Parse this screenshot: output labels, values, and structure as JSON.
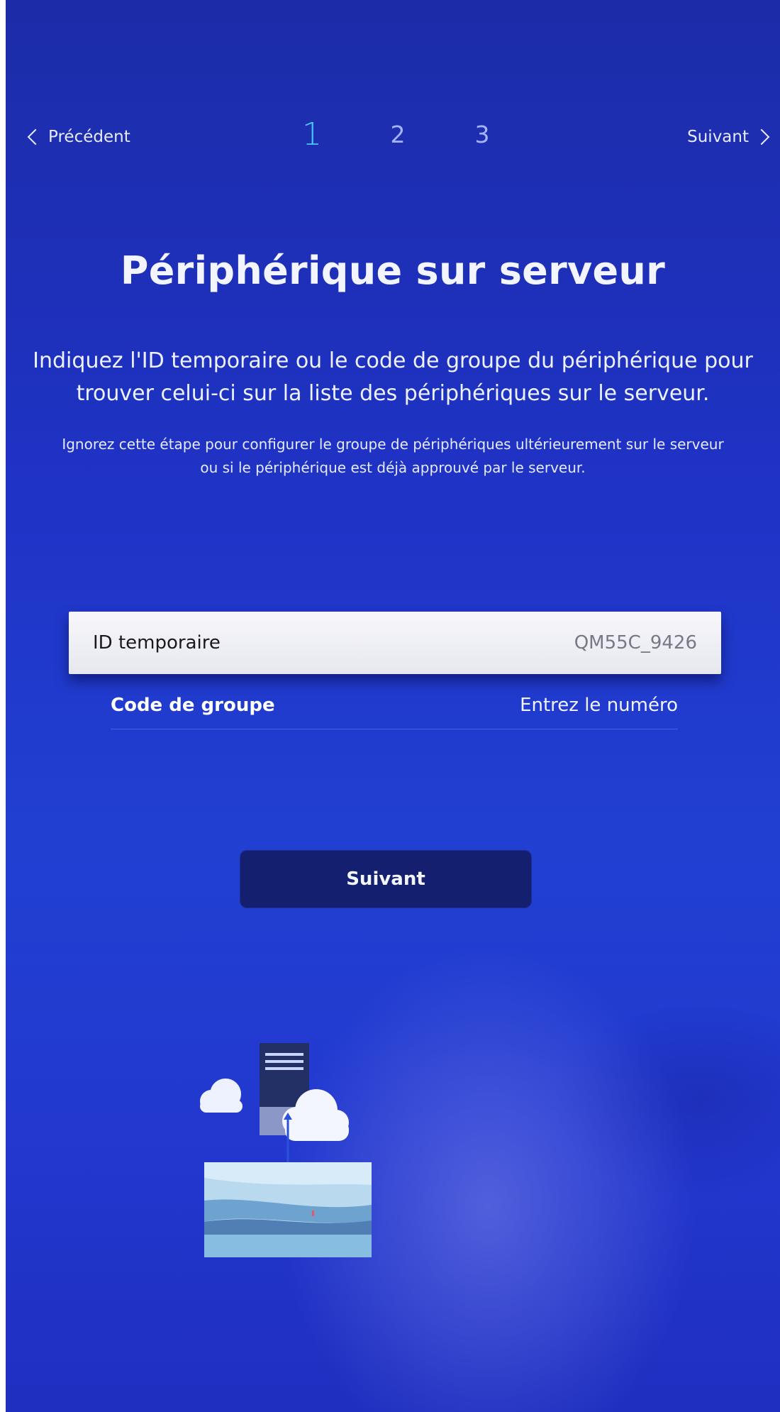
{
  "nav": {
    "previous_label": "Précédent",
    "next_label": "Suivant",
    "steps": [
      "1",
      "2",
      "3"
    ],
    "active_step": "1"
  },
  "title": "Périphérique sur serveur",
  "lead": "Indiquez l'ID temporaire ou le code de groupe du périphérique pour trouver celui-ci sur la liste des périphériques sur le serveur.",
  "note": "Ignorez cette étape pour configurer le groupe de périphériques ultérieurement sur le serveur ou si le périphérique est déjà approuvé par le serveur.",
  "fields": {
    "temp_id": {
      "label": "ID temporaire",
      "value": "QM55C_9426"
    },
    "group_code": {
      "label": "Code de groupe",
      "placeholder": "Entrez le numéro"
    }
  },
  "next_button_label": "Suivant",
  "colors": {
    "background": "#1f33c6",
    "active_step": "#46c9ff",
    "button": "#14206f",
    "selected_row": "#f2f2f6"
  }
}
